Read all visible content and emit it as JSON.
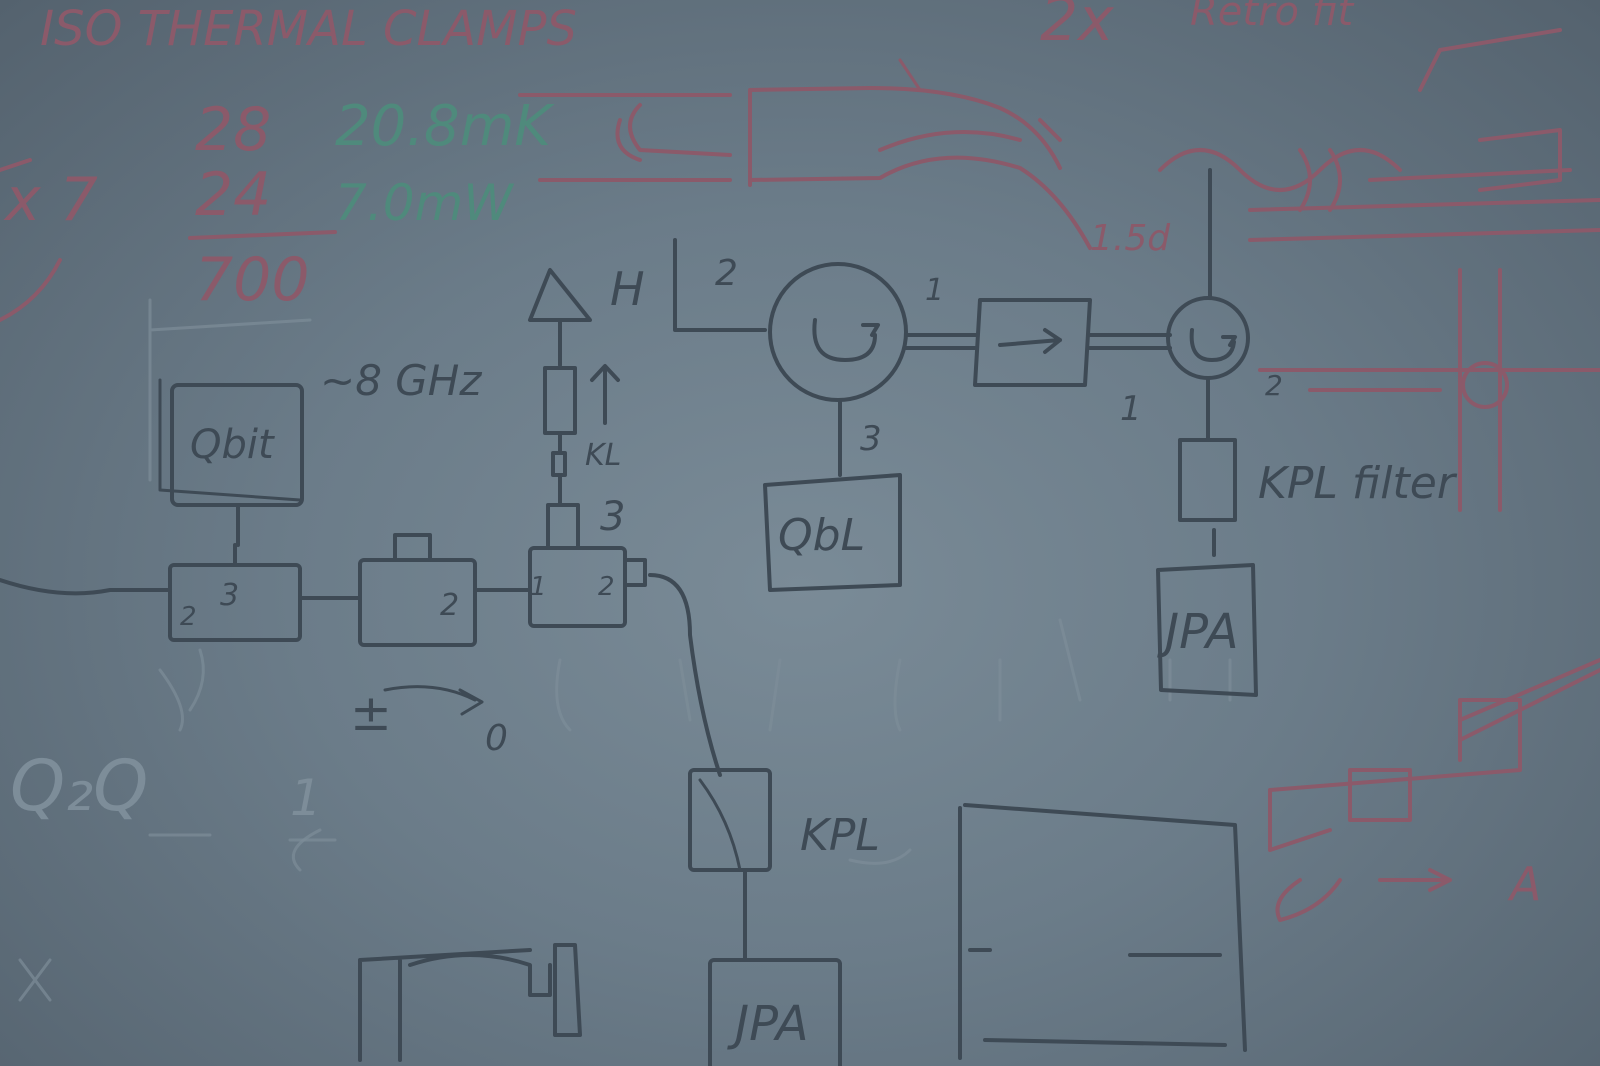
{
  "scene": {
    "colors": {
      "board": "#6b7c89",
      "marker_dark": "#3e4a55",
      "marker_red": "#8b5a6a",
      "marker_green": "#4f8a7c"
    }
  },
  "red_notes": {
    "top_left": "ISO THERMAL CLAMPS",
    "top_right": "2x",
    "top_far_right": "Retro fit",
    "calc_a": "28",
    "calc_b": "24",
    "calc_result": "700",
    "mult": "x 7",
    "bend_label": "1.5d"
  },
  "green_notes": {
    "temp": "20.8mK",
    "power": "7.0mW"
  },
  "labels": {
    "box_left": "Qbit",
    "freq": "~8 GHz",
    "hemt": "H",
    "kl_arrow": "KL",
    "port3_mid": "3",
    "port2": "2",
    "port1_circ": "1",
    "port3_circ": "3",
    "qbit_mid": "QbL",
    "circ2_port2": "2",
    "circ2_port1": "1",
    "filter_label": "KPL filter",
    "jpa_right": "JPA",
    "jpa_bottom": "JPA",
    "kpl_mid": "KPL",
    "pm_symbol": "±",
    "zero": "0",
    "q2": "Q₂Q",
    "one": "1",
    "small3": "3",
    "small2": "2",
    "small1": "1",
    "a_label": "A"
  }
}
